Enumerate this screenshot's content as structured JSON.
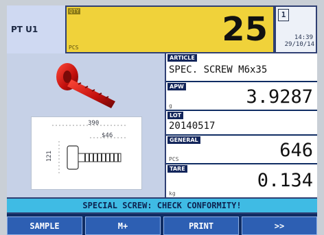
{
  "colors": {
    "background": "#0f2c63",
    "quantity_bg": "#f0d23a",
    "message_bg": "#3fbbe4",
    "softkey_bg": "#2d5fb3"
  },
  "header": {
    "station": "PT U1",
    "quantity_tag": "QTY",
    "quantity_unit": "PCS",
    "quantity_value": "25",
    "scale_number": "1",
    "time": "14:39",
    "date": "29/10/14"
  },
  "image_panel": {
    "photo_icon": "screw-photo",
    "drawing_icon": "screw-drawing",
    "dim_length": "390",
    "dim_thread": "$46",
    "dim_height": "121"
  },
  "fields": {
    "article": {
      "label": "ARTICLE",
      "value": "SPEC. SCREW M6x35"
    },
    "apw": {
      "label": "APW",
      "unit": "g",
      "value": "3.9287"
    },
    "lot": {
      "label": "LOT",
      "value": "20140517"
    },
    "general": {
      "label": "GENERAL",
      "unit": "PCS",
      "value": "646"
    },
    "tare": {
      "label": "TARE",
      "unit": "kg",
      "value": "0.134"
    }
  },
  "message": "SPECIAL SCREW: CHECK CONFORMITY!",
  "softkeys": [
    "SAMPLE",
    "M+",
    "PRINT",
    ">>"
  ]
}
